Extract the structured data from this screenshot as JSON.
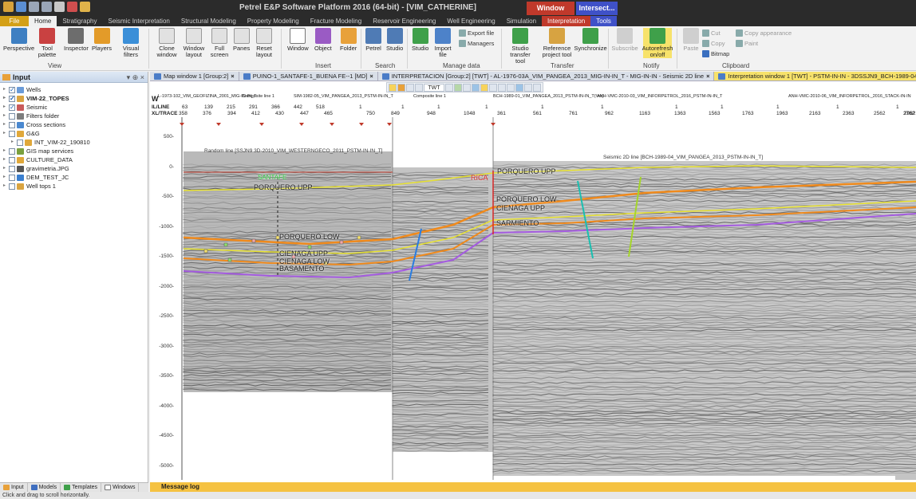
{
  "app": {
    "title": "Petrel E&P Software Platform 2016 (64-bit) - [VIM_CATHERINE]",
    "context_window": "Window",
    "context_intersect": "Intersect..."
  },
  "ribbon_tabs": [
    "File",
    "Home",
    "Stratigraphy",
    "Seismic Interpretation",
    "Structural Modeling",
    "Property Modeling",
    "Fracture Modeling",
    "Reservoir Engineering",
    "Well Engineering",
    "Simulation",
    "Interpretation",
    "Tools"
  ],
  "ribbon": {
    "buttons": {
      "perspective": "Perspective",
      "tool_palette": "Tool palette",
      "inspector": "Inspector",
      "players": "Players",
      "visual_filters": "Visual filters",
      "clone_window": "Clone window",
      "window_layout": "Window layout",
      "full_screen": "Full screen",
      "panes": "Panes",
      "reset_layout": "Reset layout",
      "window": "Window",
      "object": "Object",
      "folder": "Folder",
      "petrel": "Petrel",
      "studio_search": "Studio",
      "studio": "Studio",
      "import_file": "Import file",
      "export_file": "Export file",
      "managers": "Managers",
      "studio_transfer": "Studio transfer tool",
      "reference_project": "Reference project tool",
      "synchronize": "Synchronize",
      "subscribe": "Subscribe",
      "autorefresh": "Autorefresh on/off",
      "paste": "Paste",
      "cut": "Cut",
      "copy": "Copy",
      "bitmap": "Bitmap",
      "copy_appearance": "Copy appearance",
      "paint": "Paint"
    },
    "groups": [
      "View",
      "Insert",
      "Search",
      "Manage data",
      "Transfer",
      "Notify",
      "Clipboard"
    ]
  },
  "input_panel": {
    "title": "Input",
    "controls": "▾ ⊕ ×",
    "items": [
      {
        "label": "Wells",
        "indent": 0,
        "checked": true,
        "color": "#6a9bd8",
        "bold": false
      },
      {
        "label": "VIM-22_TOPES",
        "indent": 0,
        "checked": true,
        "color": "#d9a441",
        "bold": true
      },
      {
        "label": "Seismic",
        "indent": 0,
        "checked": true,
        "color": "#c95b5b",
        "bold": false
      },
      {
        "label": "Filters folder",
        "indent": 0,
        "checked": false,
        "color": "#7d7d7d",
        "bold": false
      },
      {
        "label": "Cross sections",
        "indent": 0,
        "checked": false,
        "color": "#4a88d0",
        "bold": false
      },
      {
        "label": "G&G",
        "indent": 0,
        "checked": false,
        "color": "#e0a83a",
        "bold": false
      },
      {
        "label": "INT_VIM-22_190810",
        "indent": 1,
        "checked": false,
        "color": "#e0a83a",
        "bold": false
      },
      {
        "label": "GIS map services",
        "indent": 0,
        "checked": false,
        "color": "#7aa03e",
        "bold": false
      },
      {
        "label": "CULTURE_DATA",
        "indent": 0,
        "checked": false,
        "color": "#e0a83a",
        "bold": false
      },
      {
        "label": "gravimetria.JPG",
        "indent": 0,
        "checked": false,
        "color": "#555555",
        "bold": false
      },
      {
        "label": "DEM_TEST_JC",
        "indent": 0,
        "checked": false,
        "color": "#3a7fd0",
        "bold": false
      },
      {
        "label": "Well tops 1",
        "indent": 0,
        "checked": false,
        "color": "#d9a441",
        "bold": false
      }
    ]
  },
  "bottom_tabs": [
    "Input",
    "Models",
    "Templates",
    "Windows"
  ],
  "message_log": "Message log",
  "status_text": "Click and drag to scroll horizontally.",
  "doc_tabs": [
    {
      "label": "Map window 1 [Group:2]",
      "active": false
    },
    {
      "label": "PUINO-1_SANTAFE-1_BUENA FE--1 [MD]",
      "active": false
    },
    {
      "label": "INTERPRETACION [Group:2] [TWT] - AL-1976-03A_VIM_PANGEA_2013_MIG-IN-IN_T - MIG-IN-IN - Seismic 2D line",
      "active": false
    },
    {
      "label": "Interpretation window 1 [TWT] - PSTM-IN-IN - 3DSSJN9_BCH-1989-04",
      "active": true
    }
  ],
  "viewer": {
    "toolbar_twt": "TWT",
    "header_rows": {
      "w_label": "W",
      "il_line": "IL/LINE",
      "xl_trace": "XL/TRACE"
    },
    "line_names": [
      "L-1973-102_VIM_GEOFIZINA_2001_MIG-IN-IN_T",
      "Composite line 1",
      "SIM-1982-05_VIM_PANGEA_2013_PSTM-IN-IN_T",
      "Composite line 1",
      "BCH-1989-01_VIM_PANGEA_2013_PSTM-IN-IN_T(Ver)",
      "ANH-VMC-2010-03_VIM_INFORPETROL_2016_PSTM-IN-IN_T",
      "ANH-VMC-2010-06_VIM_INFORPETROL_2016_STACK-IN-IN"
    ],
    "il_values": [
      "63",
      "139",
      "215",
      "291",
      "366",
      "442",
      "518",
      "1",
      "1",
      "1",
      "1",
      "1",
      "1",
      "1",
      "1",
      "1",
      "1",
      "1"
    ],
    "xl_values": [
      "358",
      "376",
      "394",
      "412",
      "430",
      "447",
      "465",
      "750",
      "849",
      "948",
      "1048",
      "361",
      "561",
      "761",
      "962",
      "1163",
      "1363",
      "1563",
      "1763",
      "1963",
      "2163",
      "2363",
      "2562",
      "2762",
      "2962"
    ],
    "y_ticks": [
      "500-",
      "0-",
      "-500-",
      "-1000-",
      "-1500-",
      "-2000-",
      "-2500-",
      "-3000-",
      "-3500-",
      "-4000-",
      "-4500-",
      "-5000-"
    ],
    "random_line_title": "Random line [SSJN9 3D-2010_VIM_WESTERNGECO_2011_PSTM-IN-IN_T]",
    "seismic_2d_title": "Seismic 2D line [BCH-1989-04_VIM_PANGEA_2013_PSTM-IN-IN_T]",
    "horizons": {
      "santafe": "SANTAFE",
      "porquero_upp_left": "PORQUERO UPP",
      "porquero_low_left": "PORQUERO LOW",
      "cienaga_upp_left": "CIENAGA UPP",
      "cienaga_low_left": "CIENAGA LOW",
      "basamento_left": "BASAMENTO",
      "rica": "RICA",
      "porquero_upp_right": "PORQUERO UPP",
      "porquero_low_right": "PORQUERO LOW",
      "cienaga_upp_right": "CIENAGA UPP",
      "sarmiento": "SARMIENTO"
    }
  },
  "colors": {
    "dark_chrome": "#2b2b2b",
    "file_tab": "#d4a017",
    "active_doc_tab": "#f7e26b",
    "message_log": "#f5c242",
    "horizon_yellow": "#e8e230",
    "horizon_orange": "#f08a1c",
    "horizon_purple": "#a45be0",
    "fault_cyan": "#1bbfb0"
  }
}
